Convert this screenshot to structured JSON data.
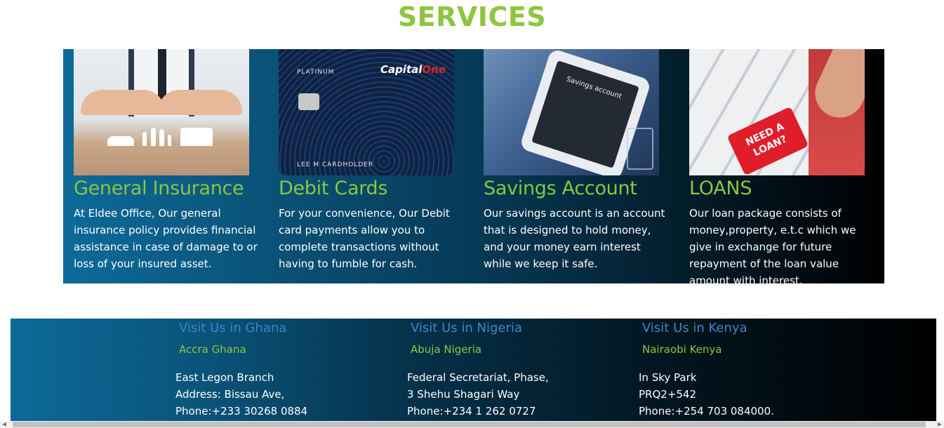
{
  "services": {
    "title": "SERVICES",
    "items": [
      {
        "title": "General Insurance",
        "description": "At Eldee Office, Our general insurance policy provides financial assistance in case of damage to or loss of your insured asset.",
        "image": "insurance-hands-family-image"
      },
      {
        "title": "Debit Cards",
        "description": "For your convenience, Our Debit card payments allow you to complete transactions without having to fumble for cash.",
        "image": "capital-one-card-image",
        "card_text": {
          "tier": "PLATINUM",
          "brand_a": "Capital",
          "brand_b": "One",
          "holder": "LEE M CARDHOLDER"
        }
      },
      {
        "title": "Savings Account",
        "description": "Our savings account is an account that is designed to hold money, and your money earn interest while we keep it safe.",
        "image": "savings-account-tablet-image",
        "screen_text": "Savings account"
      },
      {
        "title": "LOANS",
        "description": "Our loan package consists of money,property, e.t.c which we give in exchange for future repayment of the loan value amount with interest.",
        "image": "need-a-loan-key-image",
        "key_text": "NEED A LOAN?"
      }
    ]
  },
  "footer": {
    "locations": [
      {
        "heading": "Visit Us in Ghana",
        "city": "Accra Ghana",
        "lines": [
          "East Legon Branch",
          "Address: Bissau Ave,",
          "Phone:+233 30268 0884"
        ]
      },
      {
        "heading": "Visit Us in Nigeria",
        "city": "Abuja Nigeria",
        "lines": [
          "Federal Secretariat, Phase,",
          "3 Shehu Shagari Way",
          "Phone:+234 1 262 0727"
        ]
      },
      {
        "heading": "Visit Us in Kenya",
        "city": "Nairaobi Kenya",
        "lines": [
          "In Sky Park",
          "PRQ2+542",
          "Phone:+254 703 084000."
        ]
      }
    ]
  },
  "scrollbar": {
    "left_arrow": "◀",
    "right_arrow": "▶"
  },
  "colors": {
    "accent_green": "#8cc63f",
    "heading_blue": "#3a86c8",
    "panel_start": "#0d6a99",
    "panel_end": "#000000"
  }
}
